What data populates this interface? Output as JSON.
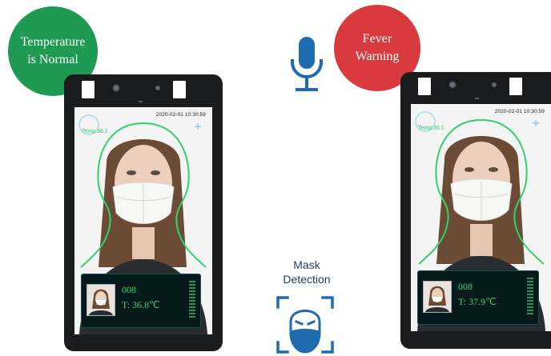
{
  "badges": {
    "normal": {
      "line1": "Temperature",
      "line2": "is Normal",
      "color": "#1e9a53"
    },
    "fever": {
      "line1": "Fever",
      "line2": "Warning",
      "color": "#d93a3d"
    }
  },
  "devices": [
    {
      "timestamp": "2020-02-01  10:30:59",
      "temp_overlay": "Temp:36.1",
      "person_id": "008",
      "temperature": "T: 36.8℃"
    },
    {
      "timestamp": "2020-02-01  10:30:59",
      "temp_overlay": "Temp:36.1",
      "person_id": "008",
      "temperature": "T: 37.9℃"
    }
  ],
  "features": {
    "microphone_icon": "microphone-icon",
    "mask_detection": {
      "line1": "Mask",
      "line2": "Detection",
      "icon": "mask-face-scan-icon",
      "color": "#1f6bb0"
    }
  },
  "colors": {
    "overlay_green": "#33cc66",
    "panel_text": "#3cd46e",
    "accent_blue": "#1f6bb0"
  }
}
